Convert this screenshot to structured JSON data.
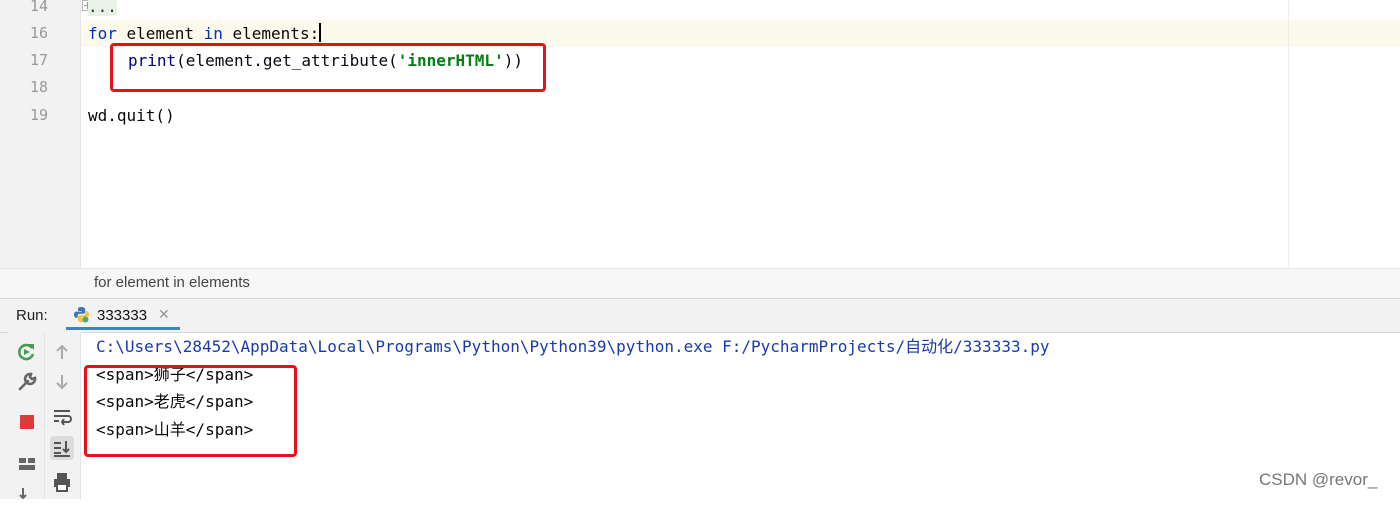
{
  "editor": {
    "lines": [
      {
        "num": "14",
        "text": "..."
      },
      {
        "num": "16",
        "kw": "for",
        "rest_a": " element ",
        "kw2": "in",
        "rest_b": " elements:"
      },
      {
        "num": "17",
        "fn": "print",
        "pre": "(element.get_attribute(",
        "str": "'innerHTML'",
        "post": "))"
      },
      {
        "num": "18",
        "text": ""
      },
      {
        "num": "19",
        "text": "wd.quit()"
      }
    ]
  },
  "breadcrumb": {
    "text": "for element in elements"
  },
  "run_panel": {
    "label": "Run:",
    "tab_name": "333333",
    "close_glyph": "✕"
  },
  "console": {
    "command": "C:\\Users\\28452\\AppData\\Local\\Programs\\Python\\Python39\\python.exe F:/PycharmProjects/自动化/333333.py",
    "output": [
      "<span>狮子</span>",
      "<span>老虎</span>",
      "<span>山羊</span>"
    ]
  },
  "watermark": "CSDN @revor_",
  "colors": {
    "highlight": "#e8101a",
    "keyword": "#0033b3",
    "string": "#067d17",
    "tab_underline": "#4083c9"
  }
}
